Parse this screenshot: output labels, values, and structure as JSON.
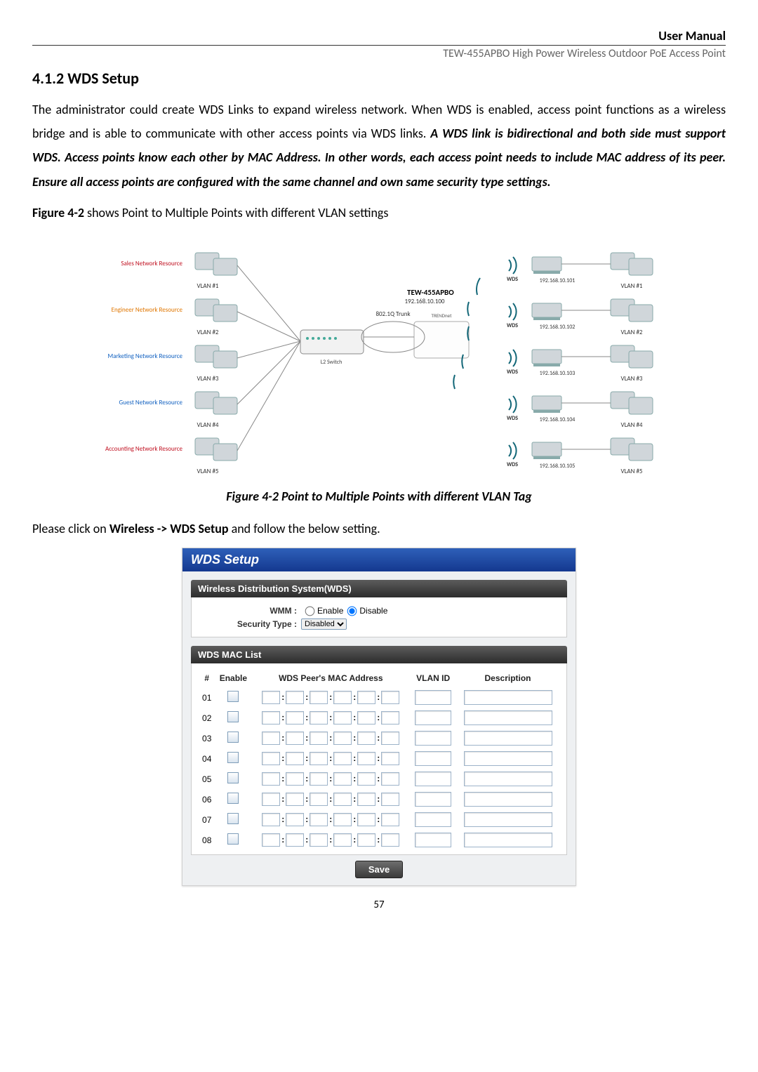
{
  "header": {
    "right_top": "User Manual",
    "right_sub": "TEW-455APBO High Power Wireless Outdoor PoE Access Point"
  },
  "section": {
    "number_title": "4.1.2 WDS Setup",
    "para1_pre": "The administrator could create WDS Links to expand wireless network. When WDS is enabled, access point functions as a wireless bridge and is able to communicate with other access points via WDS links. ",
    "para1_bi": "A WDS link is bidirectional and both side must support WDS. Access points know each other by MAC Address. In other words, each access point needs to include MAC address of its peer. Ensure all access points are configured with the same channel and own same security type settings.",
    "figref_bold": "Figure 4-2",
    "figref_rest": " shows Point to Multiple Points with different VLAN settings",
    "figcaption": "Figure 4-2 Point to Multiple Points with different VLAN Tag",
    "nav_pre": "Please click on ",
    "nav_bold": "Wireless -> WDS Setup",
    "nav_post": " and follow the below setting."
  },
  "diagram": {
    "left_resources": [
      {
        "label": "Sales Network Resource",
        "color": "#c01020",
        "vlan": "VLAN #1"
      },
      {
        "label": "Engineer Network Resource",
        "color": "#e07600",
        "vlan": "VLAN #2"
      },
      {
        "label": "Marketing Network Resource",
        "color": "#1060c0",
        "vlan": "VLAN #3"
      },
      {
        "label": "Guest Network Resource",
        "color": "#1060c0",
        "vlan": "VLAN #4"
      },
      {
        "label": "Accounting Network Resource",
        "color": "#c01020",
        "vlan": "VLAN #5"
      }
    ],
    "center_device": {
      "name": "TEW-455APBO",
      "ip": "192.168.10.100",
      "trunk": "802.1Q Trunk"
    },
    "right_clients": [
      {
        "ip": "192.168.10.101",
        "vlan": "VLAN #1"
      },
      {
        "ip": "192.168.10.102",
        "vlan": "VLAN #2"
      },
      {
        "ip": "192.168.10.103",
        "vlan": "VLAN #3"
      },
      {
        "ip": "192.168.10.104",
        "vlan": "VLAN #4"
      },
      {
        "ip": "192.168.10.105",
        "vlan": "VLAN #5"
      }
    ],
    "wds_label": "WDS"
  },
  "wds": {
    "title": "WDS Setup",
    "section1": "Wireless Distribution System(WDS)",
    "wmm_label": "WMM :",
    "wmm_enable": "Enable",
    "wmm_disable": "Disable",
    "sectype_label": "Security Type :",
    "sectype_value": "Disabled",
    "section2": "WDS MAC List",
    "cols": {
      "num": "#",
      "enable": "Enable",
      "mac": "WDS Peer's MAC Address",
      "vlan": "VLAN ID",
      "desc": "Description"
    },
    "rows": [
      "01",
      "02",
      "03",
      "04",
      "05",
      "06",
      "07",
      "08"
    ],
    "save": "Save"
  },
  "page_number": "57"
}
